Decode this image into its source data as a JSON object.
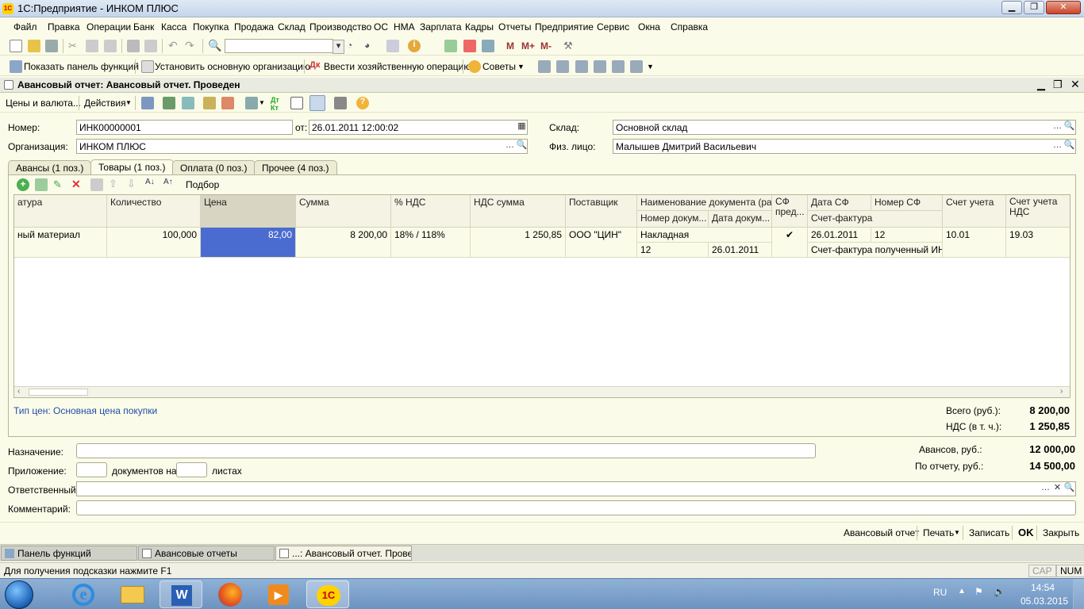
{
  "window": {
    "title": "1С:Предприятие - ИНКОМ ПЛЮС"
  },
  "menu": [
    "Файл",
    "Правка",
    "Операции",
    "Банк",
    "Касса",
    "Покупка",
    "Продажа",
    "Склад",
    "Производство",
    "ОС",
    "НМА",
    "Зарплата",
    "Кадры",
    "Отчеты",
    "Предприятие",
    "Сервис",
    "Окна",
    "Справка"
  ],
  "toolbar2": {
    "show_panel": "Показать панель функций",
    "set_org": "Установить основную организацию",
    "enter_op": "Ввести хозяйственную операцию",
    "tips": "Советы",
    "m_labels": [
      "M",
      "M+",
      "M-"
    ]
  },
  "doc": {
    "title": "Авансовый отчет: Авансовый отчет. Проведен",
    "toolbar": {
      "prices": "Цены и валюта...",
      "actions": "Действия"
    },
    "number_label": "Номер:",
    "number": "ИНК00000001",
    "from_label": "от:",
    "date": "26.01.2011 12:00:02",
    "warehouse_label": "Склад:",
    "warehouse": "Основной склад",
    "org_label": "Организация:",
    "org": "ИНКОМ ПЛЮС",
    "person_label": "Физ. лицо:",
    "person": "Малышев Дмитрий  Васильевич"
  },
  "tabs": [
    "Авансы (1 поз.)",
    "Товары (1 поз.)",
    "Оплата (0 поз.)",
    "Прочее (4 поз.)"
  ],
  "table_toolbar": {
    "pick": "Подбор"
  },
  "table": {
    "headers": {
      "nomen": "атура",
      "qty": "Количество",
      "price": "Цена",
      "sum": "Сумма",
      "vat_pct": "% НДС",
      "vat_sum": "НДС сумма",
      "supplier": "Поставщик",
      "doc_name": "Наименование документа (ра...",
      "doc_num": "Номер докум...",
      "doc_date": "Дата докум...",
      "sf_pred": "СФ пред...",
      "sf_date": "Дата СФ",
      "sf_num": "Номер СФ",
      "sf": "Счет-фактура",
      "account": "Счет учета",
      "vat_account": "Счет учета НДС"
    },
    "row": {
      "nomen": "ный материал",
      "qty": "100,000",
      "price": "82,00",
      "sum": "8 200,00",
      "vat_pct": "18% / 118%",
      "vat_sum": "1 250,85",
      "supplier": "ООО \"ЦИН\"",
      "doc_name": "Накладная",
      "doc_num": "12",
      "doc_date": "26.01.2011",
      "sf_pred": "✔",
      "sf_date": "26.01.2011",
      "sf_num": "12",
      "sf": "Счет-фактура полученный ИН...",
      "account": "10.01",
      "vat_account": "19.03"
    }
  },
  "price_type": "Тип цен: Основная цена покупки",
  "totals": {
    "total_label": "Всего (руб.):",
    "total": "8 200,00",
    "vat_label": "НДС (в т. ч.):",
    "vat": "1 250,85",
    "advances_label": "Авансов, руб.:",
    "advances": "12 000,00",
    "by_report_label": "По отчету, руб.:",
    "by_report": "14 500,00"
  },
  "bottom": {
    "purpose_label": "Назначение:",
    "attach_label": "Приложение:",
    "docs_on": "документов на",
    "sheets": "листах",
    "responsible_label": "Ответственный:",
    "comment_label": "Комментарий:"
  },
  "actions": {
    "report": "Авансовый отчет",
    "print": "Печать",
    "save": "Записать",
    "ok": "OK",
    "close": "Закрыть"
  },
  "tasks": [
    "Панель функций",
    "Авансовые отчеты",
    "...: Авансовый отчет. Прове..."
  ],
  "status": {
    "hint": "Для получения подсказки нажмите F1",
    "cap": "CAP",
    "num": "NUM"
  },
  "systray": {
    "lang": "RU",
    "time": "14:54",
    "date": "05.03.2015"
  },
  "colors": {
    "selected_cell": "#4a6bd0",
    "link": "#1f4ea8"
  }
}
